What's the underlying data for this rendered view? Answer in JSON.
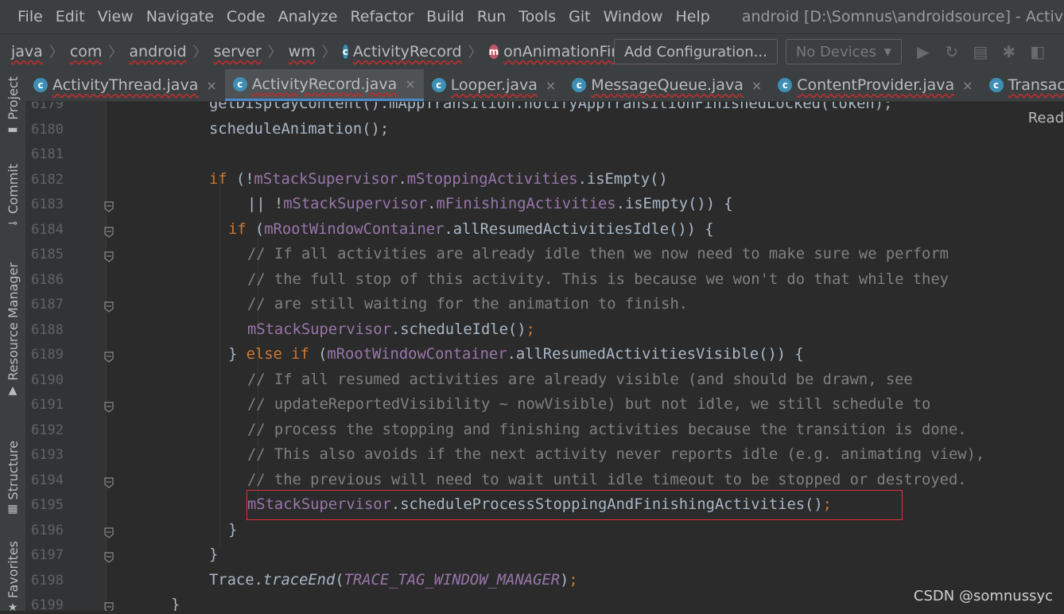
{
  "menu": [
    "File",
    "Edit",
    "View",
    "Navigate",
    "Code",
    "Analyze",
    "Refactor",
    "Build",
    "Run",
    "Tools",
    "Git",
    "Window",
    "Help"
  ],
  "window_title": "android [D:\\Somnus\\androidsource] - ActivityR",
  "breadcrumbs": [
    "java",
    "com",
    "android",
    "server",
    "wm",
    "ActivityRecord",
    "onAnimationFinished"
  ],
  "toolbar": {
    "add_configuration": "Add Configuration...",
    "no_devices": "No Devices",
    "icons": [
      "run-icon",
      "rerun-icon",
      "stop-icon",
      "debug-icon",
      "attach-debugger-icon"
    ]
  },
  "left_strip": [
    "Project",
    "Commit",
    "Resource Manager",
    "Structure",
    "Favorites"
  ],
  "tabs": [
    {
      "name": "ActivityThread.java",
      "active": false
    },
    {
      "name": "ActivityRecord.java",
      "active": true
    },
    {
      "name": "Looper.java",
      "active": false
    },
    {
      "name": "MessageQueue.java",
      "active": false
    },
    {
      "name": "ContentProvider.java",
      "active": false
    },
    {
      "name": "TransactionEx",
      "active": false
    }
  ],
  "reader_mode": "Read",
  "line_numbers": [
    "6179",
    "6180",
    "6181",
    "6182",
    "6183",
    "6184",
    "6185",
    "6186",
    "6187",
    "6188",
    "6189",
    "6190",
    "6191",
    "6192",
    "6193",
    "6194",
    "6195",
    "6196",
    "6197",
    "6198",
    "6199"
  ],
  "code_lines": [
    [
      [
        "",
        "getDisplayContent().mAppTransition.notifyAppTransitionFinishedLocked(token);"
      ]
    ],
    [
      [
        "",
        "scheduleAnimation();"
      ]
    ],
    [],
    [
      [
        "kw",
        "if "
      ],
      [
        "",
        "(!"
      ],
      [
        "fld",
        "mStackSupervisor"
      ],
      [
        "",
        "."
      ],
      [
        "fld",
        "mStoppingActivities"
      ],
      [
        "",
        ".isEmpty()"
      ]
    ],
    [
      [
        "",
        "|| !"
      ],
      [
        "fld",
        "mStackSupervisor"
      ],
      [
        "",
        "."
      ],
      [
        "fld",
        "mFinishingActivities"
      ],
      [
        "",
        ".isEmpty()) {"
      ]
    ],
    [
      [
        "kw",
        "if "
      ],
      [
        "",
        "("
      ],
      [
        "fld",
        "mRootWindowContainer"
      ],
      [
        "",
        ".allResumedActivitiesIdle()) {"
      ]
    ],
    [
      [
        "cmt",
        "// If all activities are already idle then we now need to make sure we perform"
      ]
    ],
    [
      [
        "cmt",
        "// the full stop of this activity. This is because we won't do that while they"
      ]
    ],
    [
      [
        "cmt",
        "// are still waiting for the animation to finish."
      ]
    ],
    [
      [
        "fld",
        "mStackSupervisor"
      ],
      [
        "",
        ".scheduleIdle()"
      ],
      [
        "kw",
        ";"
      ]
    ],
    [
      [
        "",
        "} "
      ],
      [
        "kw",
        "else if "
      ],
      [
        "",
        "("
      ],
      [
        "fld",
        "mRootWindowContainer"
      ],
      [
        "",
        ".allResumedActivitiesVisible()) {"
      ]
    ],
    [
      [
        "cmt",
        "// If all resumed activities are already visible (and should be drawn, see"
      ]
    ],
    [
      [
        "cmt",
        "// updateReportedVisibility ~ nowVisible) but not idle, we still schedule to"
      ]
    ],
    [
      [
        "cmt",
        "// process the stopping and finishing activities because the transition is done."
      ]
    ],
    [
      [
        "cmt",
        "// This also avoids if the next activity never reports idle (e.g. animating view),"
      ]
    ],
    [
      [
        "cmt",
        "// the previous will need to wait until idle timeout to be stopped or destroyed."
      ]
    ],
    [
      [
        "fld",
        "mStackSupervisor"
      ],
      [
        "",
        ".scheduleProcessStoppingAndFinishingActivities()"
      ],
      [
        "kw",
        ";"
      ]
    ],
    [
      [
        "",
        "}"
      ]
    ],
    [
      [
        "",
        "}"
      ]
    ],
    [
      [
        "",
        "Trace."
      ],
      [
        "it",
        "traceEnd"
      ],
      [
        "",
        "("
      ],
      [
        "cst",
        "TRACE_TAG_WINDOW_MANAGER"
      ],
      [
        "",
        ")"
      ],
      [
        "kw",
        ";"
      ]
    ],
    [
      [
        "",
        "}"
      ]
    ]
  ],
  "watermark": "CSDN @somnussyc",
  "colors": {
    "keyword": "#cc7832",
    "field": "#9876aa",
    "comment": "#808080",
    "text": "#a9b7c6",
    "highlight_border": "#d9323a"
  }
}
